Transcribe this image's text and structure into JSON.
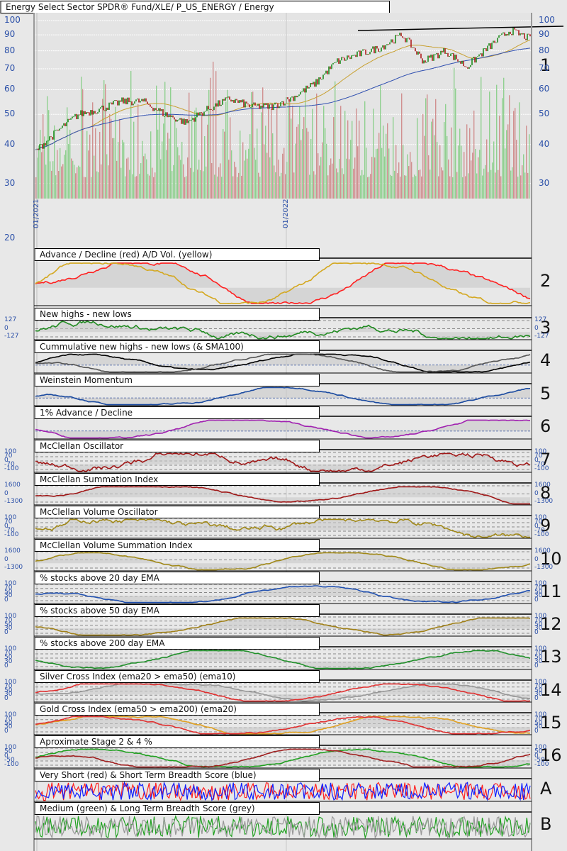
{
  "header": {
    "title": "Energy Select Sector SPDR® Fund/XLE/ P_US_ENERGY / Energy",
    "panel_number": "1"
  },
  "chart_data": {
    "type": "line",
    "title": "Energy Select Sector SPDR® Fund/XLE/ P_US_ENERGY / Energy",
    "x_ticks": [
      "01/2021",
      "01/2022"
    ],
    "price_axis_left": [
      "100",
      "90",
      "80",
      "70",
      "60",
      "50",
      "40",
      "30",
      "20"
    ],
    "price_axis_right": [
      "100",
      "90",
      "80",
      "70",
      "60",
      "50",
      "40",
      "30"
    ],
    "price_axis_values": [
      100,
      90,
      80,
      70,
      60,
      50,
      40,
      30,
      20
    ],
    "ylim": [
      20,
      110
    ],
    "price_monthly_close": {
      "months": [
        "2021-01",
        "2021-02",
        "2021-03",
        "2021-04",
        "2021-05",
        "2021-06",
        "2021-07",
        "2021-08",
        "2021-09",
        "2021-10",
        "2021-11",
        "2021-12",
        "2022-01",
        "2022-02",
        "2022-03",
        "2022-04",
        "2022-05",
        "2022-06",
        "2022-07",
        "2022-08",
        "2022-09",
        "2022-10",
        "2022-11",
        "2022-12"
      ],
      "values": [
        38,
        44,
        50,
        52,
        55,
        55,
        50,
        47,
        52,
        56,
        53,
        53,
        57,
        63,
        74,
        78,
        82,
        90,
        74,
        80,
        71,
        82,
        93,
        87
      ]
    },
    "series_colors": {
      "price_up": "#1e8c1e",
      "price_down": "#b02020",
      "sma_short": "#c8a030",
      "sma_long": "#3050b0",
      "trendline": "#000000",
      "vol_up": "#90d090",
      "vol_down": "#d09090"
    },
    "panels": [
      {
        "title": "Advance / Decline (red) A/D Vol. (yellow)",
        "num": "2",
        "left": [],
        "right": [],
        "lines": [
          "#ff2020",
          "#d4a820"
        ]
      },
      {
        "title": "New highs - new lows",
        "num": "3",
        "left": [
          "127",
          "0",
          "-127"
        ],
        "right": [
          "127",
          "0",
          "-127"
        ],
        "lines": [
          "#208a20"
        ]
      },
      {
        "title": "Cummulative new highs - new lows (& SMA100)",
        "num": "4",
        "left": [],
        "right": [],
        "lines": [
          "#000000",
          "#555555"
        ]
      },
      {
        "title": "Weinstein Momentum",
        "num": "5",
        "left": [],
        "right": [],
        "lines": [
          "#1a4aa0"
        ]
      },
      {
        "title": "1% Advance / Decline",
        "num": "6",
        "left": [],
        "right": [],
        "lines": [
          "#a020b0"
        ]
      },
      {
        "title": "McClellan Oscillator",
        "num": "7",
        "left": [
          "100",
          "70",
          "0",
          "-70",
          "-100"
        ],
        "right": [
          "100",
          "70",
          "0",
          "-70",
          "-100"
        ],
        "lines": [
          "#a01818"
        ]
      },
      {
        "title": "McClellan Summation Index",
        "num": "8",
        "left": [
          "1600",
          "0",
          "-1300"
        ],
        "right": [
          "1600",
          "0",
          "-1300"
        ],
        "lines": [
          "#a01818"
        ]
      },
      {
        "title": "McClellan Volume Oscillator",
        "num": "9",
        "left": [
          "100",
          "70",
          "0",
          "-70",
          "-100"
        ],
        "right": [
          "100",
          "70",
          "0",
          "-70",
          "-100"
        ],
        "lines": [
          "#a08818"
        ]
      },
      {
        "title": "McClellan Volume Summation Index",
        "num": "10",
        "left": [
          "1600",
          "0",
          "-1300"
        ],
        "right": [
          "1600",
          "0",
          "-1300"
        ],
        "lines": [
          "#a08818"
        ]
      },
      {
        "title": "% stocks above 20 day EMA",
        "num": "11",
        "left": [
          "100",
          "70",
          "50",
          "30",
          "0"
        ],
        "right": [
          "100",
          "70",
          "50",
          "30",
          "0"
        ],
        "lines": [
          "#2050b0"
        ]
      },
      {
        "title": "% stocks above 50 day EMA",
        "num": "12",
        "left": [
          "100",
          "70",
          "50",
          "30",
          "0"
        ],
        "right": [
          "100",
          "70",
          "50",
          "30",
          "0"
        ],
        "lines": [
          "#a08018"
        ]
      },
      {
        "title": "% stocks above 200 day EMA",
        "num": "13",
        "left": [
          "100",
          "70",
          "50",
          "30",
          "0"
        ],
        "right": [
          "100",
          "70",
          "50",
          "30",
          "0"
        ],
        "lines": [
          "#20902a"
        ]
      },
      {
        "title": "Silver Cross Index (ema20 > ema50) (ema10)",
        "num": "14",
        "left": [
          "100",
          "70",
          "50",
          "30",
          "0"
        ],
        "right": [
          "100",
          "70",
          "50",
          "30",
          "0"
        ],
        "lines": [
          "#999999",
          "#e03030"
        ]
      },
      {
        "title": "Gold Cross Index (ema50 > ema200) (ema20)",
        "num": "15",
        "left": [
          "100",
          "70",
          "50",
          "30",
          "0"
        ],
        "right": [
          "100",
          "70",
          "50",
          "30",
          "0"
        ],
        "lines": [
          "#e0a020",
          "#e03030"
        ]
      },
      {
        "title": "Aproximate Stage 2 & 4 %",
        "num": "16",
        "left": [
          "100",
          "50",
          "0",
          "-50",
          "-100"
        ],
        "right": [
          "100",
          "50",
          "0",
          "-50",
          "-100"
        ],
        "lines": [
          "#20a020",
          "#a02020"
        ]
      },
      {
        "title": "Very Short (red) & Short Term Breadth Score (blue)",
        "num": "A",
        "left": [],
        "right": [],
        "lines": [
          "#ff2020",
          "#1020ff"
        ]
      },
      {
        "title": "Medium (green) & Long Term Breadth Score (grey)",
        "num": "B",
        "left": [],
        "right": [],
        "lines": [
          "#20a020",
          "#999999"
        ]
      }
    ]
  }
}
